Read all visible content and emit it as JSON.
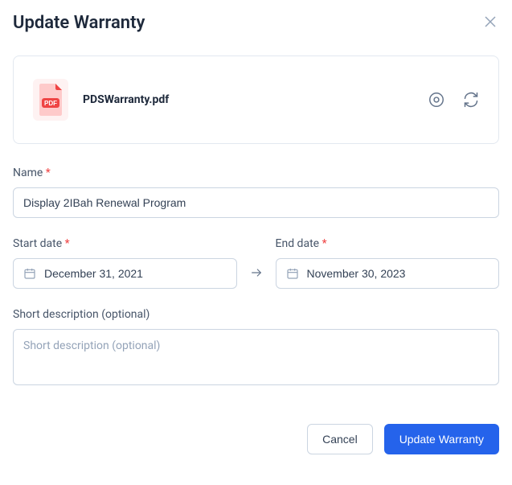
{
  "modal": {
    "title": "Update Warranty"
  },
  "attachment": {
    "badge": "PDF",
    "filename": "PDSWarranty.pdf"
  },
  "form": {
    "name": {
      "label": "Name",
      "required_mark": "*",
      "value": "Display 2IBah Renewal Program"
    },
    "start_date": {
      "label": "Start date",
      "required_mark": "*",
      "value": "December 31, 2021"
    },
    "end_date": {
      "label": "End date",
      "required_mark": "*",
      "value": "November 30, 2023"
    },
    "short_description": {
      "label": "Short description (optional)",
      "placeholder": "Short description (optional)",
      "value": ""
    }
  },
  "buttons": {
    "cancel": "Cancel",
    "submit": "Update Warranty"
  }
}
